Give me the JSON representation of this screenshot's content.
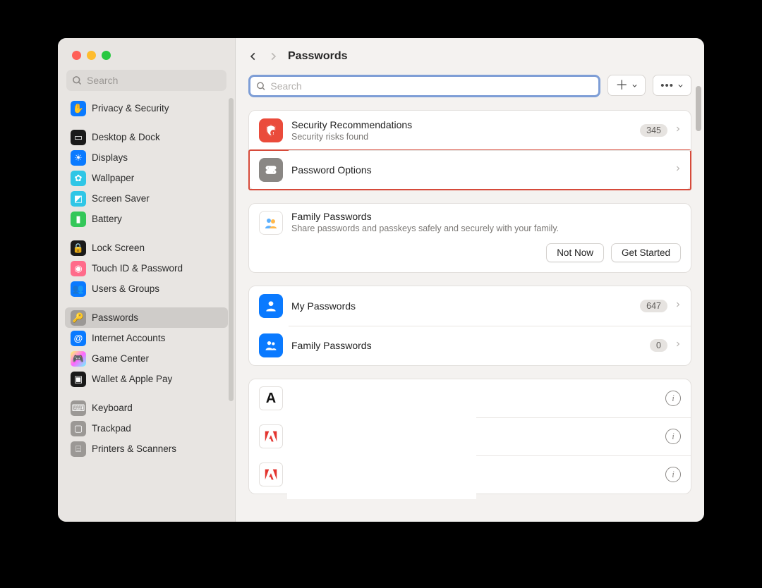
{
  "window": {
    "title": "Passwords"
  },
  "sidebar": {
    "search_placeholder": "Search",
    "items": [
      {
        "label": "Privacy & Security",
        "icon": "hand-icon",
        "bg": "#0a7aff"
      },
      {
        "sep": true
      },
      {
        "label": "Desktop & Dock",
        "icon": "dock-icon",
        "bg": "#1a1a1a"
      },
      {
        "label": "Displays",
        "icon": "sun-icon",
        "bg": "#0a7aff"
      },
      {
        "label": "Wallpaper",
        "icon": "flower-icon",
        "bg": "#2fc6e6"
      },
      {
        "label": "Screen Saver",
        "icon": "screensaver-icon",
        "bg": "#2fc6e6"
      },
      {
        "label": "Battery",
        "icon": "battery-icon",
        "bg": "#34c759"
      },
      {
        "sep": true
      },
      {
        "label": "Lock Screen",
        "icon": "lock-icon",
        "bg": "#1a1a1a"
      },
      {
        "label": "Touch ID & Password",
        "icon": "fingerprint-icon",
        "bg": "#ff6b8a"
      },
      {
        "label": "Users & Groups",
        "icon": "users-icon",
        "bg": "#0a7aff"
      },
      {
        "sep": true
      },
      {
        "label": "Passwords",
        "icon": "key-icon",
        "bg": "#9b9895",
        "selected": true
      },
      {
        "label": "Internet Accounts",
        "icon": "at-icon",
        "bg": "#0a7aff"
      },
      {
        "label": "Game Center",
        "icon": "gamecenter-icon",
        "bg": "#ffffff"
      },
      {
        "label": "Wallet & Apple Pay",
        "icon": "wallet-icon",
        "bg": "#1a1a1a"
      },
      {
        "sep": true
      },
      {
        "label": "Keyboard",
        "icon": "keyboard-icon",
        "bg": "#9b9895"
      },
      {
        "label": "Trackpad",
        "icon": "trackpad-icon",
        "bg": "#9b9895"
      },
      {
        "label": "Printers & Scanners",
        "icon": "printer-icon",
        "bg": "#9b9895"
      }
    ]
  },
  "toolbar": {
    "search_placeholder": "Search",
    "add_label": "+",
    "more_label": "•••"
  },
  "sections": {
    "security": {
      "title": "Security Recommendations",
      "subtitle": "Security risks found",
      "badge": "345"
    },
    "options": {
      "title": "Password Options"
    },
    "family_promo": {
      "title": "Family Passwords",
      "subtitle": "Share passwords and passkeys safely and securely with your family.",
      "not_now": "Not Now",
      "get_started": "Get Started"
    },
    "groups": {
      "mine": {
        "title": "My Passwords",
        "badge": "647"
      },
      "family": {
        "title": "Family Passwords",
        "badge": "0"
      }
    },
    "entries": [
      {
        "initial": "A",
        "fg": "#111",
        "bg": "#fff"
      },
      {
        "initial": "A",
        "fg": "#e3342f",
        "bg": "#fff",
        "shape": "adobe"
      },
      {
        "initial": "A",
        "fg": "#e3342f",
        "bg": "#fff",
        "shape": "adobe"
      }
    ]
  }
}
